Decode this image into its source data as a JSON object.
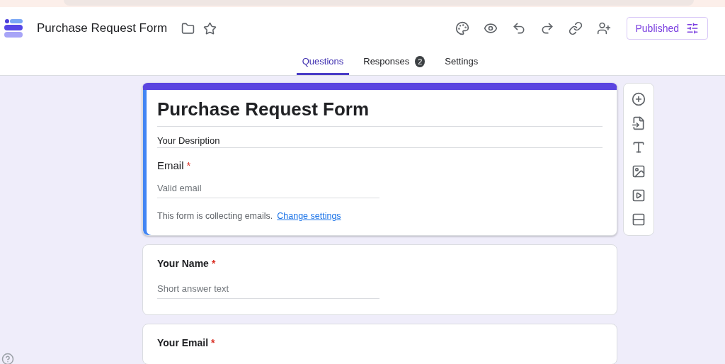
{
  "header": {
    "title": "Purchase Request Form",
    "publish_button": "Published"
  },
  "tabs": [
    {
      "label": "Questions",
      "selected": true
    },
    {
      "label": "Responses",
      "selected": false,
      "badge": "2"
    },
    {
      "label": "Settings",
      "selected": false
    }
  ],
  "form_header": {
    "selected": true,
    "title": "Purchase Request Form",
    "description": "Your Desription",
    "email_label": "Email",
    "email_required": true,
    "required_mark": "*",
    "email_placeholder": "Valid email",
    "notice": "This form is collecting emails.",
    "notice_link": "Change settings"
  },
  "questions": [
    {
      "title": "Your Name",
      "required": true,
      "placeholder": "Short answer text"
    },
    {
      "title": "Your Email",
      "required": true
    }
  ]
}
